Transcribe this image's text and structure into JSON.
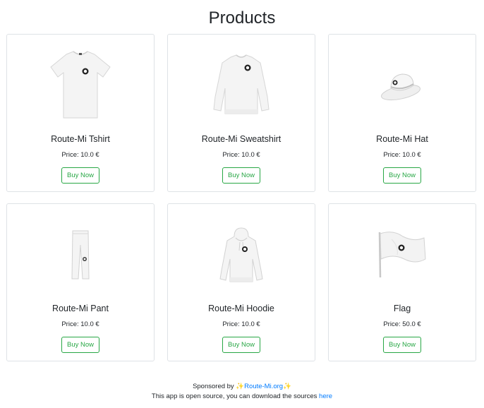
{
  "page": {
    "title": "Products"
  },
  "products": [
    {
      "name": "Route-Mi Tshirt",
      "price": "Price: 10.0 €",
      "button": "Buy Now",
      "icon": "tshirt-image"
    },
    {
      "name": "Route-Mi Sweatshirt",
      "price": "Price: 10.0 €",
      "button": "Buy Now",
      "icon": "sweatshirt-image"
    },
    {
      "name": "Route-Mi Hat",
      "price": "Price: 10.0 €",
      "button": "Buy Now",
      "icon": "hat-image"
    },
    {
      "name": "Route-Mi Pant",
      "price": "Price: 10.0 €",
      "button": "Buy Now",
      "icon": "pant-image"
    },
    {
      "name": "Route-Mi Hoodie",
      "price": "Price: 10.0 €",
      "button": "Buy Now",
      "icon": "hoodie-image"
    },
    {
      "name": "Flag",
      "price": "Price: 50.0 €",
      "button": "Buy Now",
      "icon": "flag-image"
    }
  ],
  "footer": {
    "sponsored_prefix": "Sponsored by ",
    "sponsor_sparkle_left": "✨",
    "sponsor_link": "Route-Mi.org",
    "sponsor_sparkle_right": "✨",
    "source_text": "This app is open source, you can download the sources ",
    "source_link": "here"
  },
  "colors": {
    "accent_green": "#28a745",
    "link_blue": "#007bff",
    "border": "#dee2e6"
  }
}
